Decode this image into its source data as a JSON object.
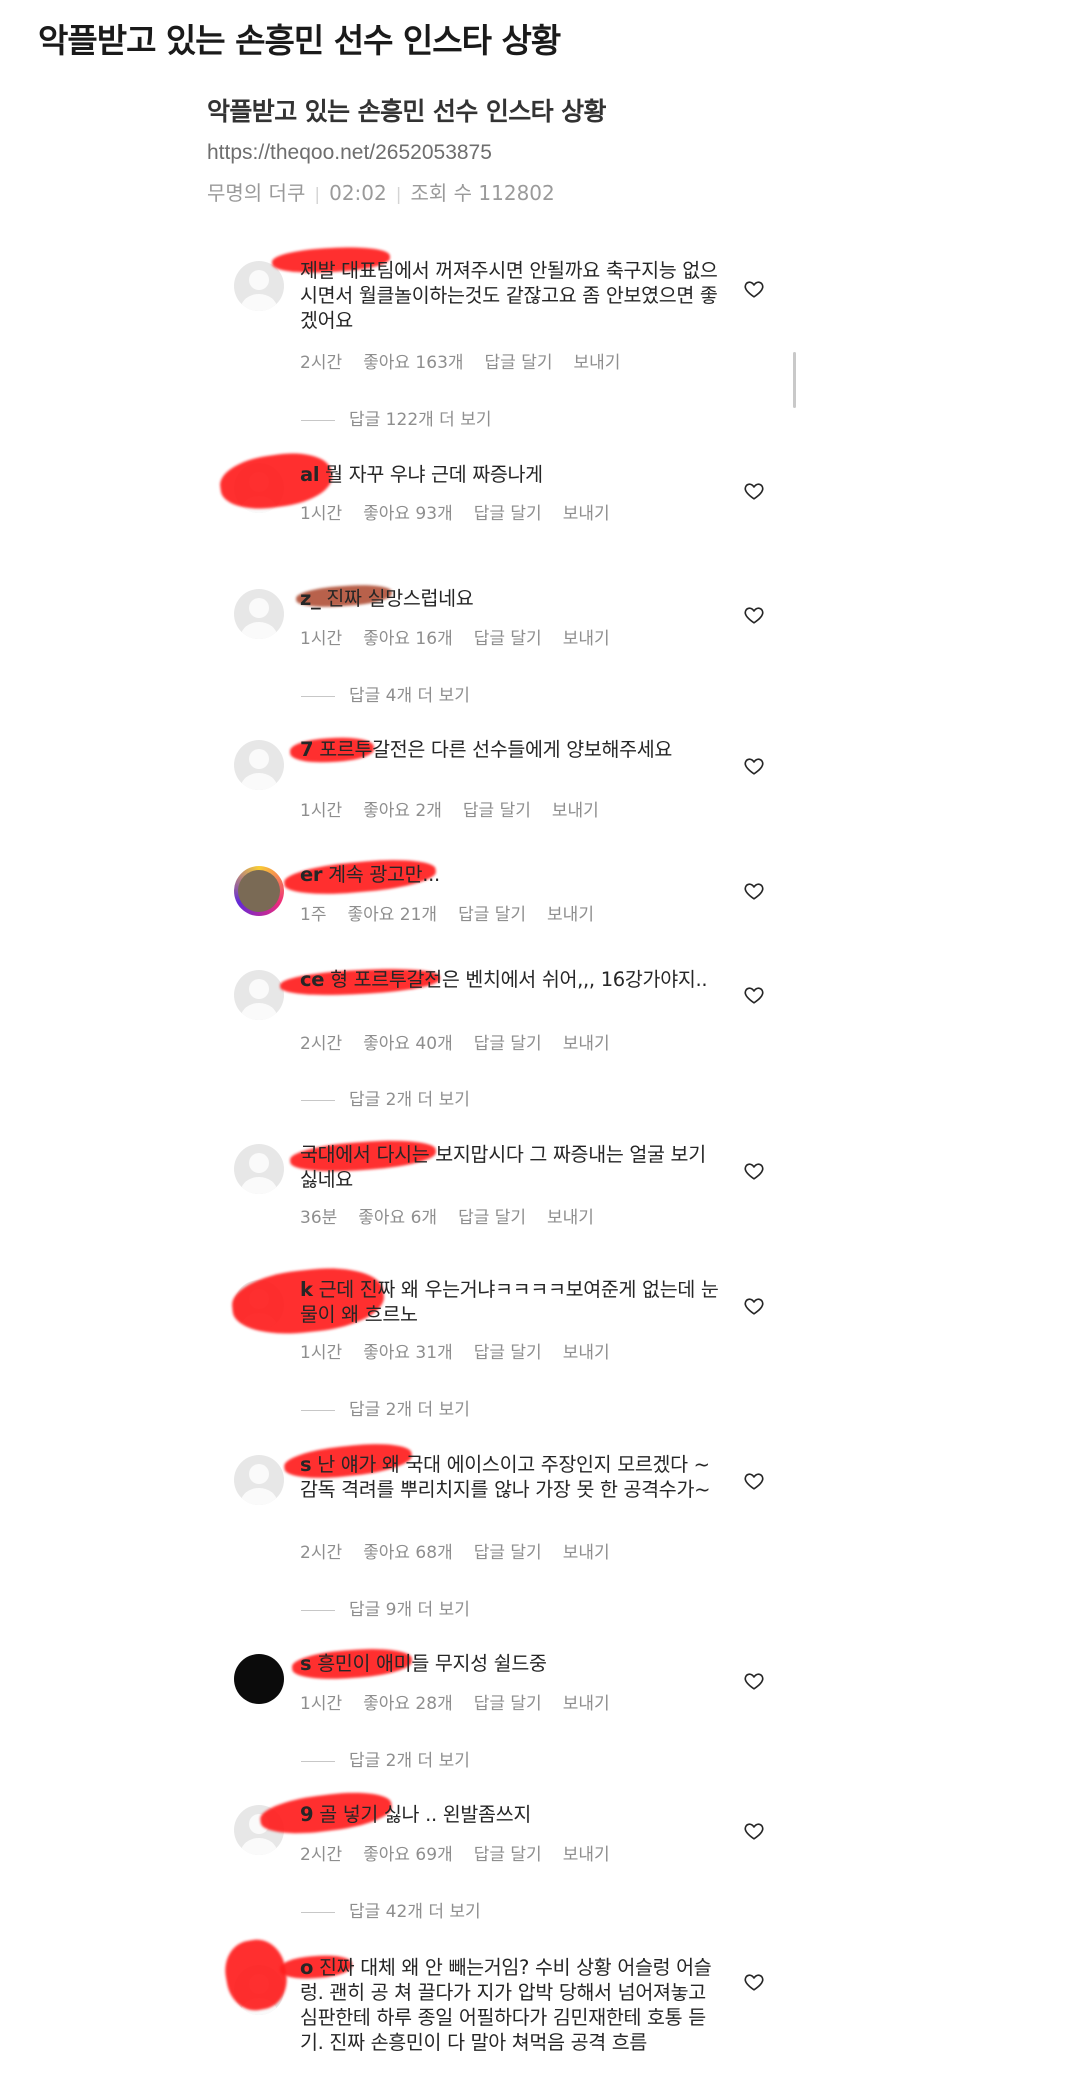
{
  "page": {
    "title": "악플받고 있는 손흥민 선수 인스타 상황"
  },
  "source": {
    "title": "악플받고 있는 손흥민 선수 인스타 상황",
    "url": "https://theqoo.net/2652053875",
    "author": "무명의 더쿠",
    "time": "02:02",
    "views_label": "조회 수",
    "views": "112802"
  },
  "labels": {
    "reply": "답글 달기",
    "send": "보내기"
  },
  "comments": [
    {
      "user": "",
      "text": "제발 대표팀에서 꺼져주시면 안될까요 축구지능 없으시면서 월클놀이하는것도 같잖고요 좀 안보였으면 좋겠어요",
      "time": "2시간",
      "likes": "좋아요 163개",
      "more_replies": "답글 122개 더 보기"
    },
    {
      "user": "al",
      "text": "뭘 자꾸 우냐 근데 짜증나게",
      "time": "1시간",
      "likes": "좋아요 93개",
      "more_replies": ""
    },
    {
      "user": "z_",
      "text": "진짜 실망스럽네요",
      "time": "1시간",
      "likes": "좋아요 16개",
      "more_replies": "답글 4개 더 보기"
    },
    {
      "user": "7",
      "text": "포르투갈전은 다른 선수들에게 양보해주세요",
      "time": "1시간",
      "likes": "좋아요 2개",
      "more_replies": ""
    },
    {
      "user": "er",
      "text": "계속 광고만...",
      "time": "1주",
      "likes": "좋아요 21개",
      "more_replies": ""
    },
    {
      "user": "ce",
      "text": "형 포르투갈전은 벤치에서 쉬어,,, 16강가야지..",
      "time": "2시간",
      "likes": "좋아요 40개",
      "more_replies": "답글 2개 더 보기"
    },
    {
      "user": "",
      "text": "국대에서 다시는 보지맙시다 그 짜증내는 얼굴 보기 싫네요",
      "time": "36분",
      "likes": "좋아요 6개",
      "more_replies": ""
    },
    {
      "user": "k",
      "text": "근데 진짜 왜 우는거냐ㅋㅋㅋㅋ보여준게 없는데 눈물이 왜 흐르노",
      "time": "1시간",
      "likes": "좋아요 31개",
      "more_replies": "답글 2개 더 보기"
    },
    {
      "user": "s",
      "text": "난 얘가 왜 국대 에이스이고 주장인지 모르겠다 ~ 감독 격려를 뿌리치지를 않나 가장 못 한 공격수가~",
      "time": "2시간",
      "likes": "좋아요 68개",
      "more_replies": "답글 9개 더 보기"
    },
    {
      "user": "s",
      "text": "흥민이 애미들 무지성 쉴드중",
      "time": "1시간",
      "likes": "좋아요 28개",
      "more_replies": "답글 2개 더 보기"
    },
    {
      "user": "9",
      "text": "골 넣기 싫나 .. 왼발좀쓰지",
      "time": "2시간",
      "likes": "좋아요 69개",
      "more_replies": "답글 42개 더 보기"
    },
    {
      "user": "o",
      "text": "진짜 대체 왜 안 빼는거임? 수비 상황 어슬렁 어슬렁. 괜히 공 쳐 끌다가 지가 압박 당해서 넘어져놓고 심판한테 하루 종일 어필하다가 김민재한테 호통 듣기. 진짜 손흥민이 다 말아 쳐먹음 공격 흐름",
      "time": "",
      "likes": "",
      "more_replies": ""
    }
  ]
}
